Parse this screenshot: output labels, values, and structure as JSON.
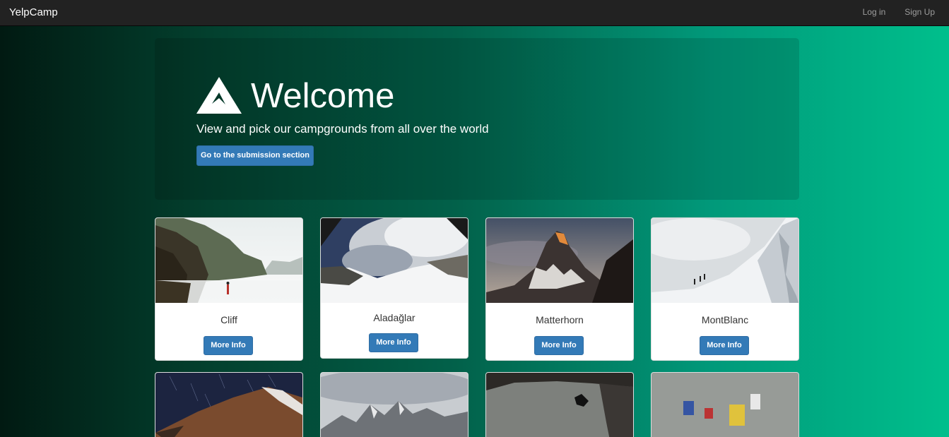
{
  "navbar": {
    "brand": "YelpCamp",
    "login_label": "Log in",
    "signup_label": "Sign Up"
  },
  "jumbotron": {
    "icon": "mountain-icon",
    "title": "Welcome",
    "subtitle": "View and pick our campgrounds from all over the world",
    "button_label": "Go to the submission section"
  },
  "campgrounds": [
    {
      "name": "Cliff",
      "button_label": "More Info"
    },
    {
      "name": "Aladağlar",
      "button_label": "More Info"
    },
    {
      "name": "Matterhorn",
      "button_label": "More Info"
    },
    {
      "name": "MontBlanc",
      "button_label": "More Info"
    }
  ],
  "colors": {
    "navbar_bg": "#222222",
    "brand_text": "#ffffff",
    "nav_link": "#9d9d9d",
    "button_primary": "#337ab7",
    "gradient_start": "#011a12",
    "gradient_end": "#00bf8c"
  }
}
